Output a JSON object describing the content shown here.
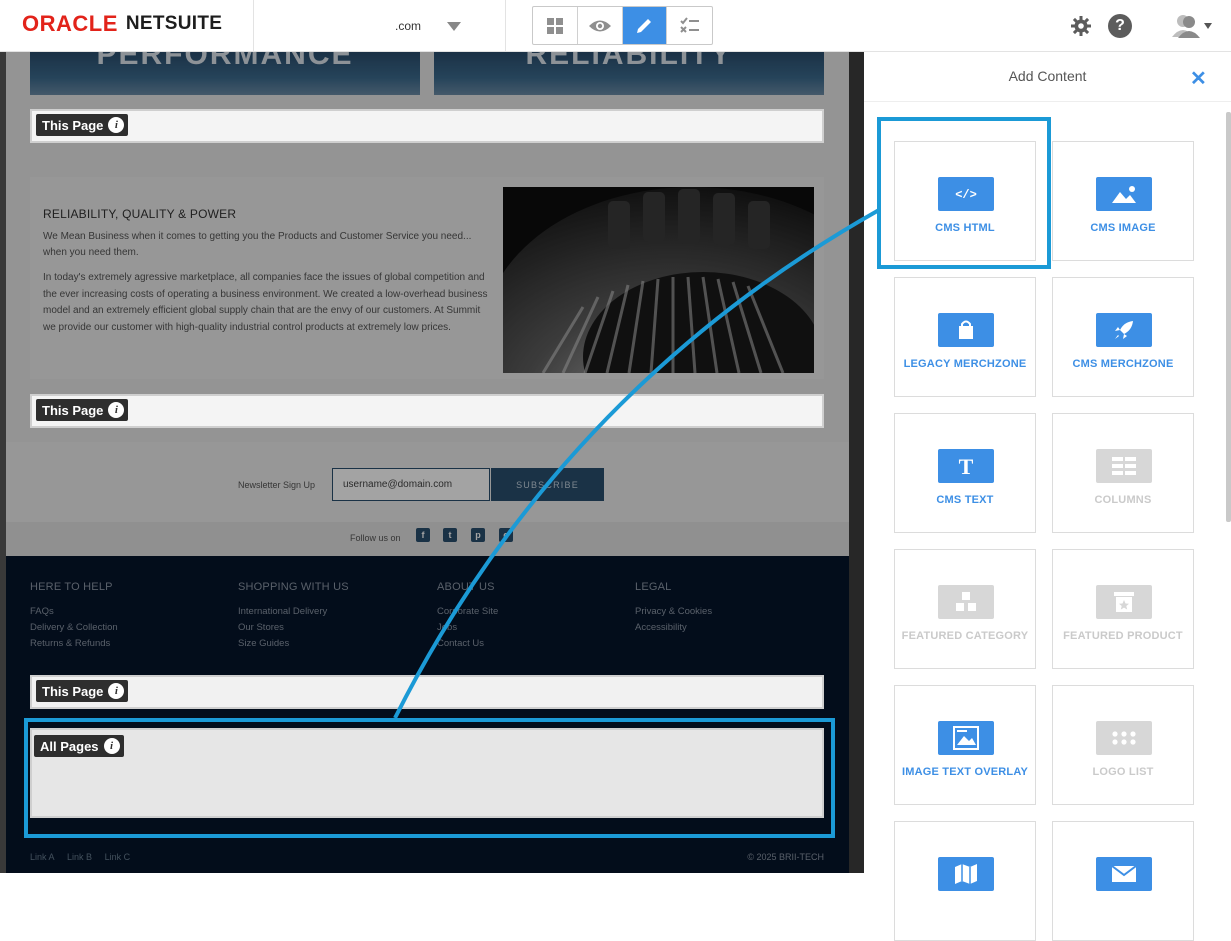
{
  "topbar": {
    "logo_oracle": "ORACLE",
    "logo_netsuite": "NETSUITE",
    "site_domain": ".com",
    "mode_icons": [
      "grid-icon",
      "eye-icon",
      "pencil-icon",
      "checklist-icon"
    ],
    "active_mode": "pencil-icon",
    "help_label": "?"
  },
  "page": {
    "hero_left": "PERFORMANCE",
    "hero_right": "RELIABILITY",
    "drop_this_page": "This Page",
    "drop_all_pages": "All Pages",
    "info_glyph": "i",
    "feature": {
      "heading": "RELIABILITY, QUALITY & POWER",
      "p1": "We Mean Business when it comes to getting you the Products and Customer Service you need... when you need them.",
      "p2": "In today's extremely agressive marketplace, all companies face the issues of global competition and the ever increasing costs of operating a business environment. We created a low-overhead business model and an extremely efficient global supply chain that are the envy of our customers. At Summit we provide our customer with high-quality industrial control products at extremely low prices."
    },
    "newsletter": {
      "label": "Newsletter Sign Up",
      "input_value": "username@domain.com",
      "button": "SUBSCRIBE"
    },
    "follow_label": "Follow us on",
    "social": [
      "f",
      "t",
      "p",
      "o"
    ],
    "footer": {
      "columns": [
        {
          "heading": "HERE TO HELP",
          "links": [
            "FAQs",
            "Delivery & Collection",
            "Returns & Refunds"
          ]
        },
        {
          "heading": "SHOPPING WITH US",
          "links": [
            "International Delivery",
            "Our Stores",
            "Size Guides"
          ]
        },
        {
          "heading": "ABOUT US",
          "links": [
            "Corporate Site",
            "Jobs",
            "Contact Us"
          ]
        },
        {
          "heading": "LEGAL",
          "links": [
            "Privacy & Cookies",
            "Accessibility"
          ]
        }
      ],
      "bottom_links": [
        "Link A",
        "Link B",
        "Link C"
      ],
      "copyright": "© 2025 BRII-TECH"
    }
  },
  "panel": {
    "title": "Add Content",
    "close": "✕",
    "tiles": [
      {
        "label": "CMS HTML",
        "icon": "code-icon",
        "enabled": true
      },
      {
        "label": "CMS IMAGE",
        "icon": "image-icon",
        "enabled": true
      },
      {
        "label": "LEGACY MERCHZONE",
        "icon": "shopping-bag-icon",
        "enabled": true
      },
      {
        "label": "CMS MERCHZONE",
        "icon": "rocket-icon",
        "enabled": true
      },
      {
        "label": "CMS TEXT",
        "icon": "text-icon",
        "enabled": true
      },
      {
        "label": "COLUMNS",
        "icon": "columns-icon",
        "enabled": false
      },
      {
        "label": "FEATURED CATEGORY",
        "icon": "category-icon",
        "enabled": false
      },
      {
        "label": "FEATURED PRODUCT",
        "icon": "product-star-icon",
        "enabled": false
      },
      {
        "label": "IMAGE TEXT OVERLAY",
        "icon": "image-overlay-icon",
        "enabled": true
      },
      {
        "label": "LOGO LIST",
        "icon": "dots-grid-icon",
        "enabled": false
      },
      {
        "label": "",
        "icon": "map-icon",
        "enabled": true
      },
      {
        "label": "",
        "icon": "envelope-icon",
        "enabled": true
      }
    ]
  },
  "colors": {
    "accent": "#3d8fe5",
    "annotation": "#1b9ad6",
    "oracle_red": "#e2231a",
    "footer_bg": "#06152b"
  }
}
